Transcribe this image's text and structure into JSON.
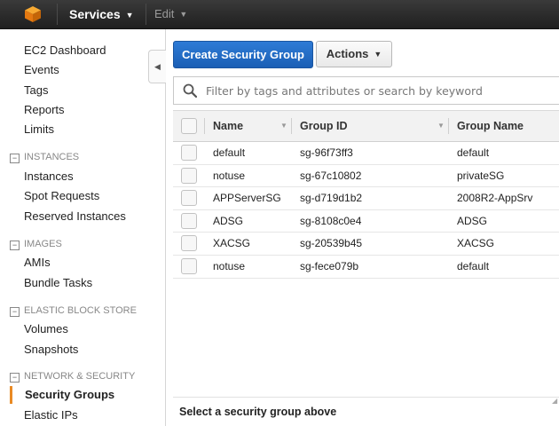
{
  "topbar": {
    "logo_icon": "aws-cube-icon",
    "services_label": "Services",
    "edit_label": "Edit"
  },
  "sidebar": {
    "ec2_dashboard": "EC2 Dashboard",
    "events": "Events",
    "tags": "Tags",
    "reports": "Reports",
    "limits": "Limits",
    "instances_section": "INSTANCES",
    "instances": "Instances",
    "spot_requests": "Spot Requests",
    "reserved_instances": "Reserved Instances",
    "images_section": "IMAGES",
    "amis": "AMIs",
    "bundle_tasks": "Bundle Tasks",
    "ebs_section": "ELASTIC BLOCK STORE",
    "volumes": "Volumes",
    "snapshots": "Snapshots",
    "network_section": "NETWORK & SECURITY",
    "security_groups": "Security Groups",
    "elastic_ips": "Elastic IPs"
  },
  "toolbar": {
    "create_label": "Create Security Group",
    "actions_label": "Actions"
  },
  "filter": {
    "placeholder": "Filter by tags and attributes or search by keyword"
  },
  "table": {
    "headers": {
      "name": "Name",
      "group_id": "Group ID",
      "group_name": "Group Name"
    },
    "rows": [
      {
        "name": "default",
        "group_id": "sg-96f73ff3",
        "group_name": "default"
      },
      {
        "name": "notuse",
        "group_id": "sg-67c10802",
        "group_name": "privateSG"
      },
      {
        "name": "APPServerSG",
        "group_id": "sg-d719d1b2",
        "group_name": "2008R2-AppSrv"
      },
      {
        "name": "ADSG",
        "group_id": "sg-8108c0e4",
        "group_name": "ADSG"
      },
      {
        "name": "XACSG",
        "group_id": "sg-20539b45",
        "group_name": "XACSG"
      },
      {
        "name": "notuse",
        "group_id": "sg-fece079b",
        "group_name": "default"
      }
    ]
  },
  "detail": {
    "empty_text": "Select a security group above"
  },
  "colors": {
    "primary_button": "#1f66c1",
    "active_indicator": "#e98a24",
    "topbar": "#2b2b2b"
  }
}
